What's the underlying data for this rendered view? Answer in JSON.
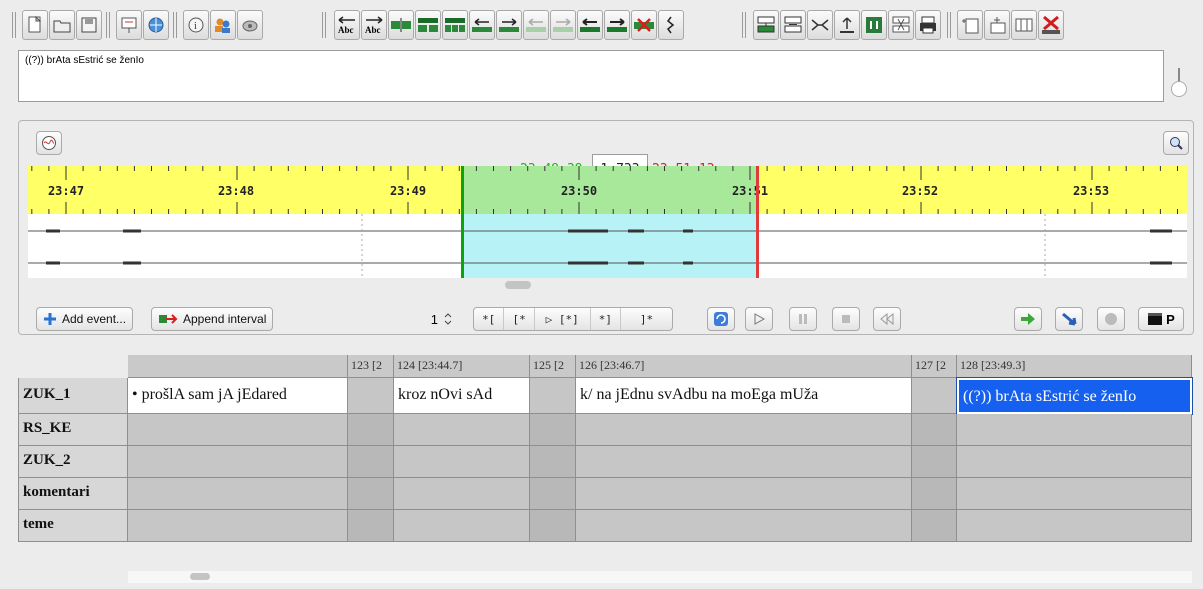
{
  "toolbar": {
    "icons": [
      "new-transcription-icon",
      "open-icon",
      "save-icon",
      "presentation-icon",
      "web-icon",
      "info-icon",
      "speakers-icon",
      "disk-icon",
      "move-left-text-icon",
      "move-right-text-icon",
      "split-icon",
      "merge-icon",
      "merge-more-icon",
      "shift-left-icon",
      "shift-right-icon",
      "shift-left-disabled-icon",
      "shift-right-disabled-icon",
      "move-boundary-left-icon",
      "move-boundary-right-icon",
      "remove-gap-icon",
      "squiggle-icon",
      "tier-insert-icon",
      "tier-move-icon",
      "tier-split-icon",
      "tier-up-icon",
      "tier-merge-icon",
      "tier-x-icon",
      "tier-print-icon",
      "tier-a-icon",
      "tier-b-icon",
      "tier-c-icon",
      "delete-tier-icon"
    ]
  },
  "editor": {
    "text": "((?)) brAta sEstrić se ženIo"
  },
  "timeline": {
    "start": "23:49.39",
    "duration": "1.733",
    "end": "23:51.13",
    "ticks": [
      "23:47",
      "23:48",
      "23:49",
      "23:50",
      "23:51",
      "23:52",
      "23:53"
    ]
  },
  "controls": {
    "add_event": "Add event...",
    "append_interval": "Append interval",
    "step_value": "1",
    "bracket_buttons": [
      "*[",
      "[*",
      "▷ [*]",
      "*]",
      "]*"
    ],
    "p_label": "P"
  },
  "table": {
    "headers": [
      "",
      "123 [2",
      "124 [23:44.7]",
      "125 [2",
      "126 [23:46.7]",
      "127 [2",
      "128 [23:49.3]"
    ],
    "tiers": [
      "ZUK_1",
      "RS_KE",
      "ZUK_2",
      "komentari",
      "teme"
    ],
    "zuk1_events": [
      "• prošlA sam jA jEdared",
      "",
      "kroz nOvi sAd",
      "",
      "k/ na jEdnu svAdbu na moEga mUža",
      "",
      "((?)) brAta sEstrić se ženIo"
    ]
  },
  "colors": {
    "ruler": "#ffff66",
    "selection_ruler": "#a8e89a",
    "selection_wave": "#b7f2f6",
    "cursor_start": "#0ba40b",
    "cursor_end": "#e23a3a",
    "selected_event": "#1560ee"
  }
}
